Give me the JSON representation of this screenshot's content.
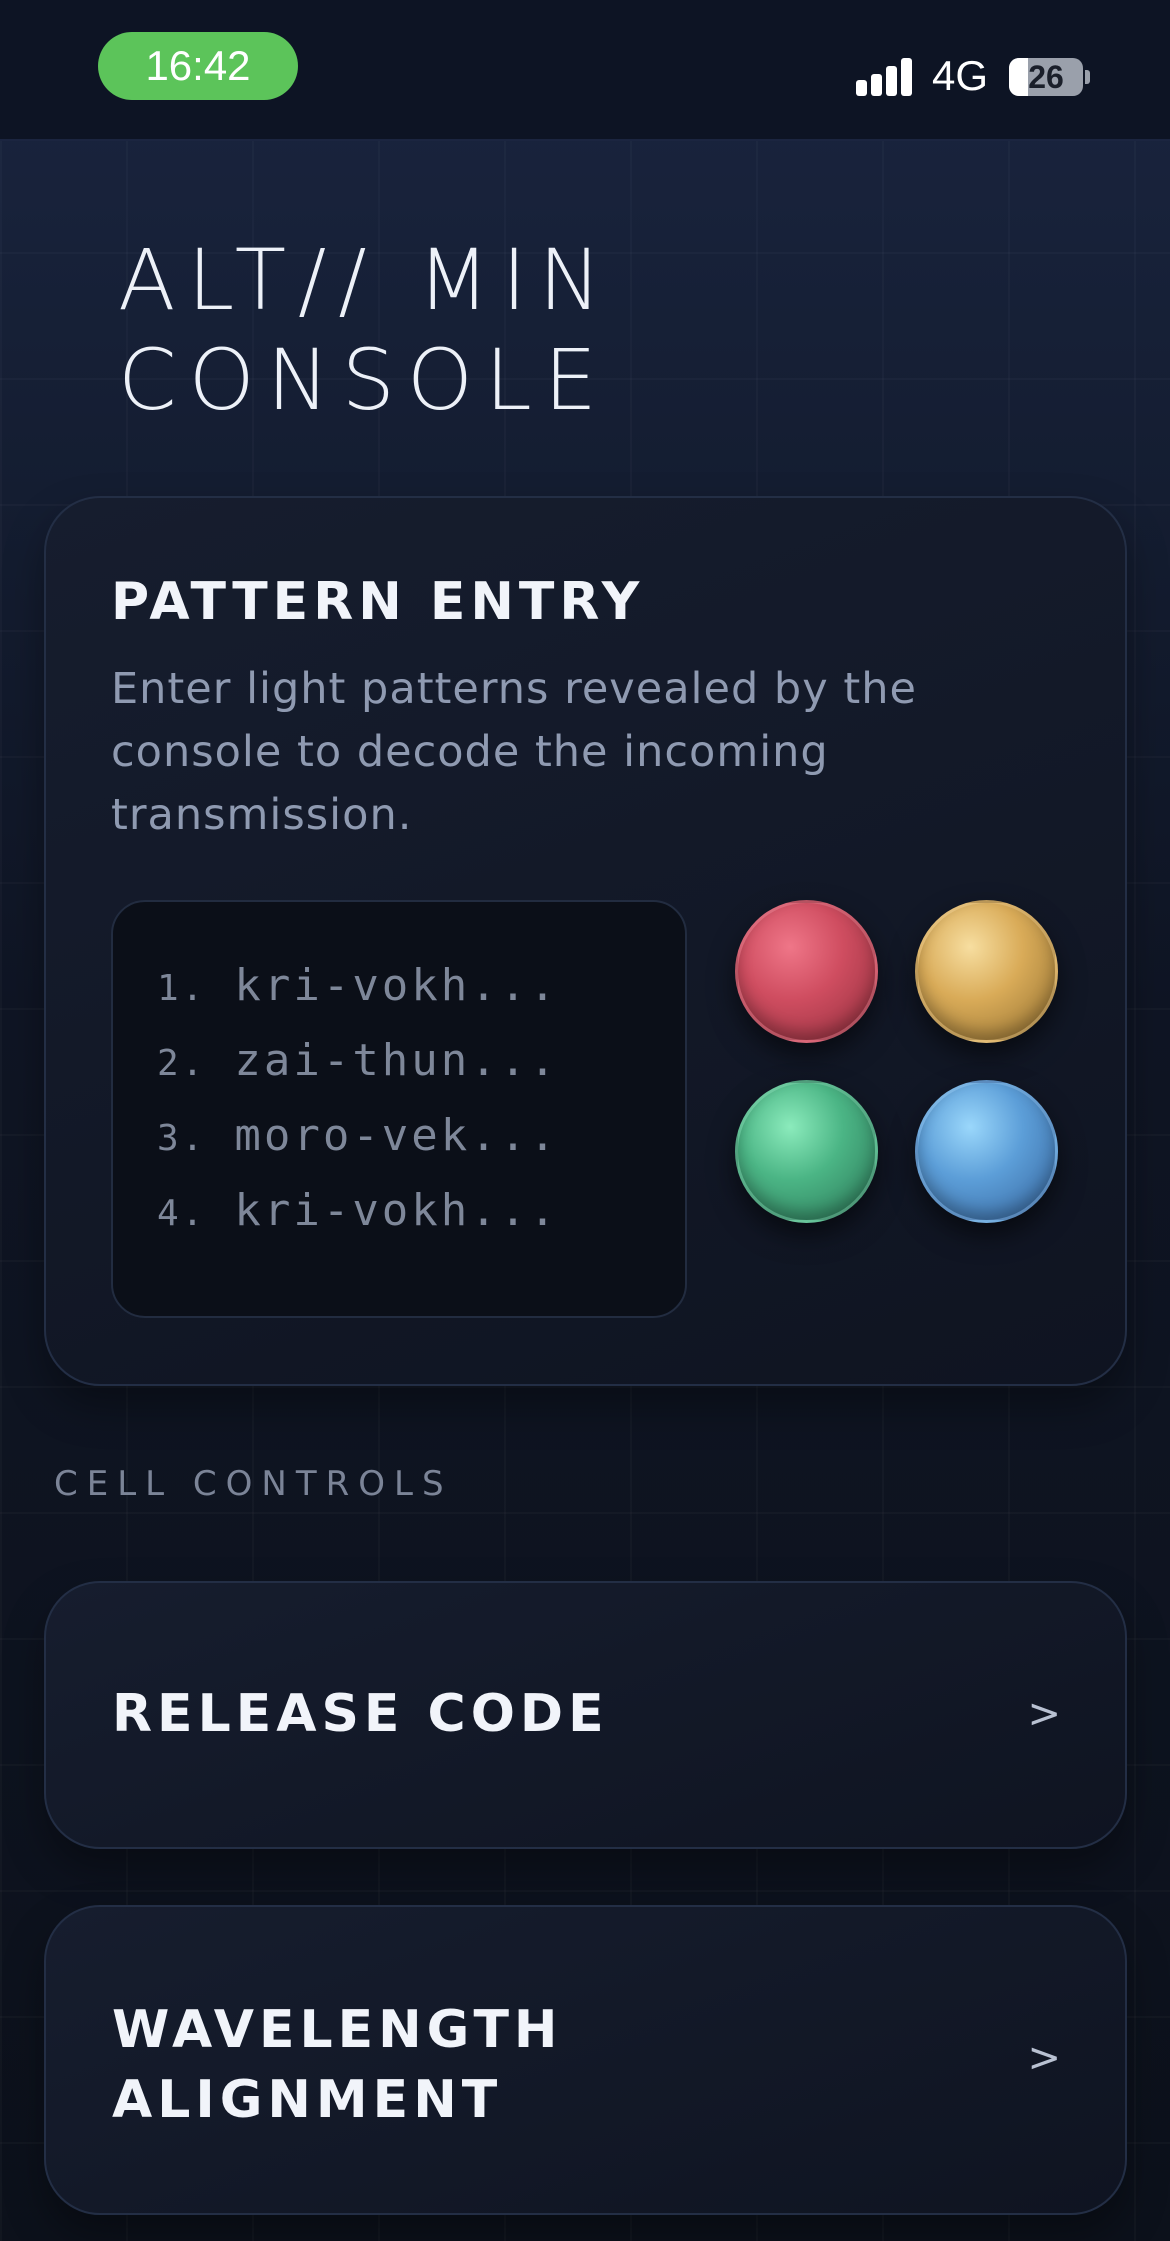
{
  "status_bar": {
    "time": "16:42",
    "network": "4G",
    "battery": "26",
    "battery_level": 0.26,
    "icons": [
      "signal-bars-icon",
      "battery-icon"
    ]
  },
  "title": "ALT// MIN CONSOLE",
  "pattern_entry": {
    "heading": "PATTERN ENTRY",
    "description": "Enter light patterns revealed by the console to decode the incoming transmission.",
    "codes": [
      {
        "num": "1.",
        "text": "kri-vokh..."
      },
      {
        "num": "2.",
        "text": "zai-thun..."
      },
      {
        "num": "3.",
        "text": "moro-vek..."
      },
      {
        "num": "4.",
        "text": "kri-vokh..."
      }
    ],
    "orbs": [
      {
        "name": "red",
        "color": "#cf4d60"
      },
      {
        "name": "yellow",
        "color": "#d9ab58"
      },
      {
        "name": "green",
        "color": "#4bb585"
      },
      {
        "name": "blue",
        "color": "#5c9ed8"
      }
    ]
  },
  "cell_controls": {
    "section_label": "CELL CONTROLS",
    "items": [
      {
        "label": "RELEASE CODE",
        "chevron": ">"
      },
      {
        "label_line1": "WAVELENGTH",
        "label_line2": "ALIGNMENT",
        "chevron": ">"
      }
    ]
  }
}
